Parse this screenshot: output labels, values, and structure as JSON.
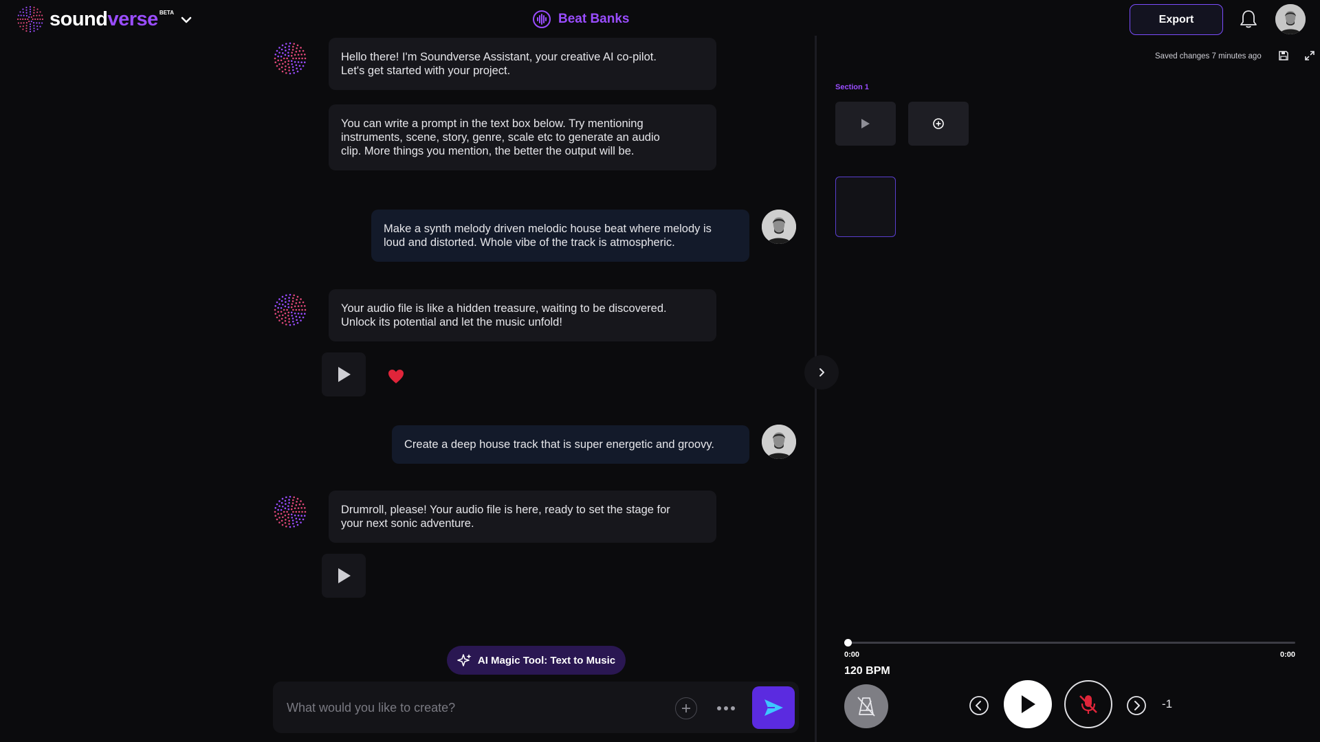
{
  "brand": {
    "name_part1": "sound",
    "name_part2": "verse",
    "badge": "BETA"
  },
  "project": {
    "title": "Beat Banks"
  },
  "toolbar": {
    "export_label": "Export"
  },
  "chat": {
    "messages": [
      {
        "role": "assistant",
        "line1": "Hello there! I'm Soundverse Assistant, your creative AI co-pilot.",
        "line2": "Let's get started with your project."
      },
      {
        "role": "assistant",
        "line1": "You can write a prompt in the text box below. Try mentioning",
        "line2": "instruments, scene, story, genre, scale etc to generate an audio",
        "line3": "clip. More things you mention, the better the output will be."
      },
      {
        "role": "user",
        "line1": "Make a synth melody driven melodic house beat where melody is",
        "line2": "loud and distorted. Whole vibe of the track is atmospheric."
      },
      {
        "role": "assistant",
        "line1": "Your audio file is like a hidden treasure, waiting to be discovered.",
        "line2": "Unlock its potential and let the music unfold!"
      },
      {
        "role": "user",
        "line1": "Create a deep house track that is super energetic and groovy."
      },
      {
        "role": "assistant",
        "line1": "Drumroll, please! Your audio file is here, ready to set the stage for",
        "line2": "your next sonic adventure."
      }
    ],
    "liked_first_audio": true,
    "magic_tool_label": "AI Magic Tool: Text to Music",
    "input_placeholder": "What would you like to create?"
  },
  "editor": {
    "saved_status": "Saved changes 7 minutes ago",
    "section_label": "Section 1"
  },
  "player": {
    "time_current": "0:00",
    "time_total": "0:00",
    "progress_fraction": 0,
    "bpm_label": "120 BPM",
    "offset_label": "-1"
  },
  "colors": {
    "accent": "#9a4dff",
    "send_button": "#5b2be0",
    "heart": "#e0253a",
    "mute": "#e0253a"
  }
}
